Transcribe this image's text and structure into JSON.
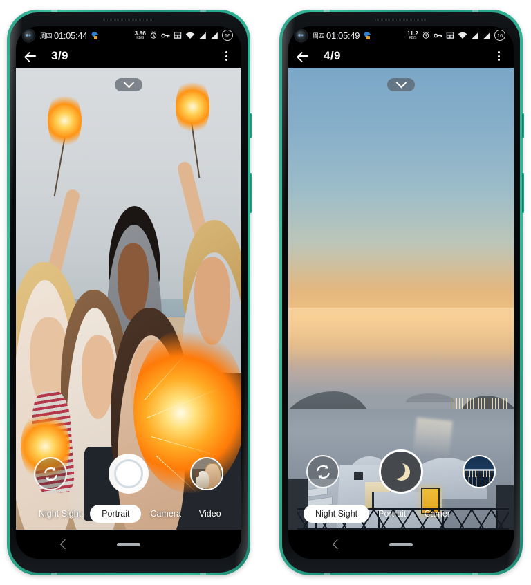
{
  "phones": [
    {
      "id": "phone-left",
      "status_bar": {
        "day": "周四",
        "time": "01:05:44",
        "weather_icon": "weather-icon",
        "net_speed_value": "3.86",
        "net_speed_unit": "KB/S",
        "icons": [
          "alarm-icon",
          "vpn-key-icon",
          "nfc-icon",
          "wifi-icon",
          "signal-sim1-icon",
          "signal-sim2-icon"
        ],
        "battery_level": "16"
      },
      "action_bar": {
        "back_icon": "back-arrow-icon",
        "counter": "3/9",
        "overflow_icon": "more-options-icon"
      },
      "viewfinder": {
        "collapse_icon": "chevron-down-icon",
        "scene": "beach-group-selfie-with-sparklers"
      },
      "controls": {
        "flip_camera_icon": "flip-camera-icon",
        "shutter_icon": "shutter-button",
        "shutter_style": "light",
        "thumbnail": "woman-with-dog-thumbnail"
      },
      "modes": [
        {
          "label": "Night Sight",
          "active": false
        },
        {
          "label": "Portrait",
          "active": true
        },
        {
          "label": "Camera",
          "active": false
        },
        {
          "label": "Video",
          "active": false
        }
      ],
      "nav_bar": {
        "back_icon": "nav-back-icon",
        "home_icon": "nav-home-indicator"
      }
    },
    {
      "id": "phone-right",
      "status_bar": {
        "day": "周四",
        "time": "01:05:49",
        "weather_icon": "weather-icon",
        "net_speed_value": "11.2",
        "net_speed_unit": "KB/S",
        "icons": [
          "alarm-icon",
          "vpn-key-icon",
          "nfc-icon",
          "wifi-icon",
          "signal-sim1-icon",
          "signal-sim2-icon"
        ],
        "battery_level": "16"
      },
      "action_bar": {
        "back_icon": "back-arrow-icon",
        "counter": "4/9",
        "overflow_icon": "more-options-icon"
      },
      "viewfinder": {
        "collapse_icon": "chevron-down-icon",
        "scene": "santorini-sunset-seascape"
      },
      "controls": {
        "flip_camera_icon": "flip-camera-icon",
        "shutter_icon": "night-sight-moon-button",
        "shutter_style": "night",
        "thumbnail": "night-cityscape-thumbnail"
      },
      "modes": [
        {
          "label": "Night Sight",
          "active": true
        },
        {
          "label": "Portrait",
          "active": false
        },
        {
          "label": "Camer",
          "active": false
        }
      ],
      "nav_bar": {
        "back_icon": "nav-back-icon",
        "home_icon": "nav-home-indicator"
      }
    }
  ],
  "colors": {
    "frame": "#2fa58c",
    "screen_bg": "#000000",
    "status_text": "#e9eaec",
    "mode_active_bg": "#ffffff",
    "mode_active_text": "#1f2225",
    "nav_icon": "#9aa0a6"
  }
}
